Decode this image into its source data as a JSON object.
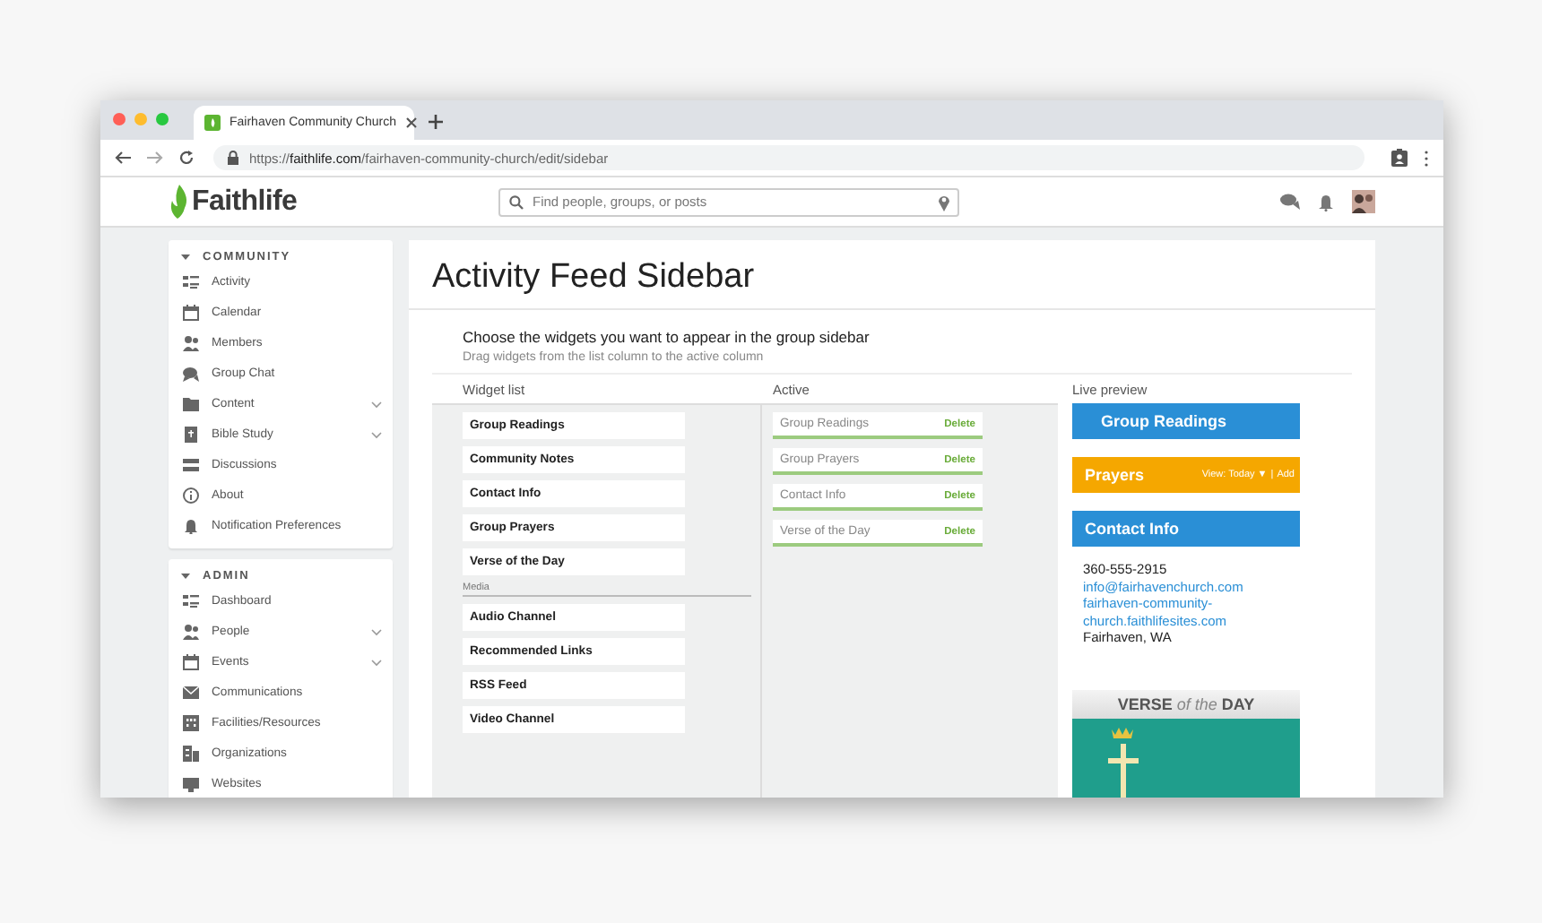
{
  "browser": {
    "tab_title": "Fairhaven Community Church",
    "url_scheme": "https://",
    "url_domain": "faithlife.com",
    "url_path": "/fairhaven-community-church/edit/sidebar"
  },
  "header": {
    "logo": "Faithlife",
    "search": {
      "placeholder": "Find people, groups, or posts"
    }
  },
  "sidebar": [
    {
      "title": "COMMUNITY",
      "expanded": true,
      "items": [
        {
          "label": "Activity",
          "has_submenu": false
        },
        {
          "label": "Calendar",
          "has_submenu": false
        },
        {
          "label": "Members",
          "has_submenu": false
        },
        {
          "label": "Group Chat",
          "has_submenu": false
        },
        {
          "label": "Content",
          "has_submenu": true
        },
        {
          "label": "Bible Study",
          "has_submenu": true
        },
        {
          "label": "Discussions",
          "has_submenu": false
        },
        {
          "label": "About",
          "has_submenu": false
        },
        {
          "label": "Notification Preferences",
          "has_submenu": false
        }
      ]
    },
    {
      "title": "ADMIN",
      "expanded": true,
      "items": [
        {
          "label": "Dashboard",
          "has_submenu": false
        },
        {
          "label": "People",
          "has_submenu": true
        },
        {
          "label": "Events",
          "has_submenu": true
        },
        {
          "label": "Communications",
          "has_submenu": false
        },
        {
          "label": "Facilities/Resources",
          "has_submenu": false
        },
        {
          "label": "Organizations",
          "has_submenu": false
        },
        {
          "label": "Websites",
          "has_submenu": false
        }
      ]
    }
  ],
  "page": {
    "title": "Activity Feed Sidebar",
    "intro": "Choose the widgets you want to appear in the group sidebar",
    "hint": "Drag widgets from the list column to the active column"
  },
  "widget_list": {
    "heading": "Widget list",
    "groups": [
      {
        "items": [
          "Group Readings",
          "Community Notes",
          "Contact Info",
          "Group Prayers",
          "Verse of the Day"
        ]
      },
      {
        "title": "Media",
        "items": [
          "Audio Channel",
          "Recommended Links",
          "RSS Feed",
          "Video Channel"
        ]
      }
    ]
  },
  "active": {
    "heading": "Active",
    "items": [
      {
        "label": "Group Readings",
        "action": "Delete"
      },
      {
        "label": "Group Prayers",
        "action": "Delete"
      },
      {
        "label": "Contact Info",
        "action": "Delete"
      },
      {
        "label": "Verse of the Day",
        "action": "Delete"
      }
    ]
  },
  "live_preview": {
    "heading": "Live preview",
    "widgets": [
      {
        "kind": "heading",
        "title": "Group Readings",
        "color": "#2a8fd6"
      },
      {
        "kind": "prayers",
        "title": "Prayers",
        "color": "#f5a700",
        "view": "View: Today ▼",
        "separator": "|",
        "add": "Add"
      },
      {
        "kind": "contact",
        "title": "Contact Info",
        "color": "#2a8fd6",
        "phone": "360-555-2915",
        "email": "info@fairhavenchurch.com",
        "website": "fairhaven-community-church.faithlifesites.com",
        "location": "Fairhaven, WA"
      },
      {
        "kind": "verse",
        "title_start": "VERSE",
        "title_middle": "of the",
        "title_end": "DAY"
      }
    ]
  }
}
